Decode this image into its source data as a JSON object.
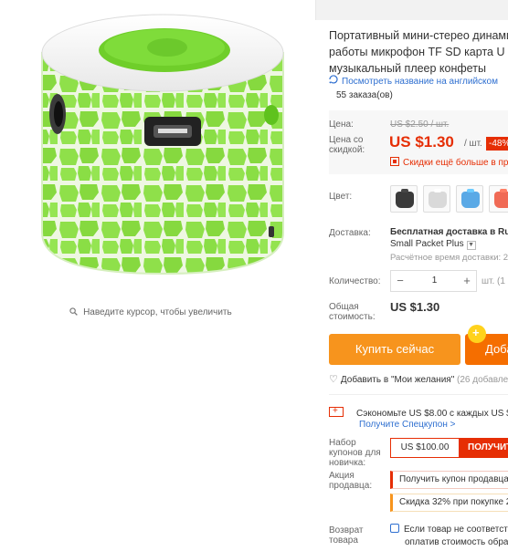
{
  "gallery": {
    "zoom_hint": "Наведите курсор, чтобы увеличить",
    "zoom_icon": "magnifier-icon"
  },
  "product": {
    "title_lines": [
      "Портативный мини-стерео динами",
      "работы микрофон TF SD карта U ди",
      "музыкальный плеер конфеты"
    ],
    "translate_link": "Посмотреть название на английском",
    "orders": "55 заказа(ов)"
  },
  "price": {
    "price_label": "Цена:",
    "old_price": "US $2.50 / шт.",
    "discount_label_lines": [
      "Цена со",
      "скидкой:"
    ],
    "new_price": "US $1.30",
    "per_unit": "/ шт.",
    "discount_badge": "-48%",
    "qr_text": "Скидки ещё больше в при"
  },
  "options": {
    "color_label": "Цвет:",
    "swatches": [
      {
        "name": "black",
        "color": "#3a3a3a"
      },
      {
        "name": "white",
        "color": "#d9d9d9"
      },
      {
        "name": "blue",
        "color": "#5aa9e6"
      },
      {
        "name": "red",
        "color": "#f06a55"
      }
    ]
  },
  "shipping": {
    "label": "Доставка:",
    "main": "Бесплатная доставка в Rus",
    "method": "Small Packet Plus",
    "time": "Расчётное время доставки: 2"
  },
  "quantity": {
    "label": "Количество:",
    "minus": "−",
    "value": "1",
    "plus": "+",
    "note": "шт. (1 шт."
  },
  "total": {
    "label_lines": [
      "Общая",
      "стоимость:"
    ],
    "value": "US $1.30"
  },
  "actions": {
    "buy_now": "Купить сейчас",
    "add_to_cart": "Доба",
    "wishlist": "Добавить в \"Мои желания\"",
    "wishlist_count": "(26 добавле"
  },
  "coupons": {
    "save_text": "Сэкономьте US $8.00 с каждых US $",
    "save_link": "Получите Спецкупон >",
    "new_user_label_lines": [
      "Набор",
      "купонов для",
      "новичка:"
    ],
    "coupon_amount": "US $100.00",
    "coupon_button": "ПОЛУЧИТЕ",
    "promo_label_lines": [
      "Акция",
      "продавца:"
    ],
    "promo1": "Получить купон продавца",
    "promo2": "Скидка 32% при покупке 2"
  },
  "returns": {
    "label_lines": [
      "Возврат",
      "товара"
    ],
    "text_lines": [
      "Если товар не соответств",
      "оплатив стоимость обратн"
    ]
  },
  "colors": {
    "accent_red": "#e62e04",
    "buy_orange": "#f7941d",
    "cart_orange": "#f56e00",
    "link_blue": "#2e6fd0",
    "product_green": "#8fe04a"
  }
}
